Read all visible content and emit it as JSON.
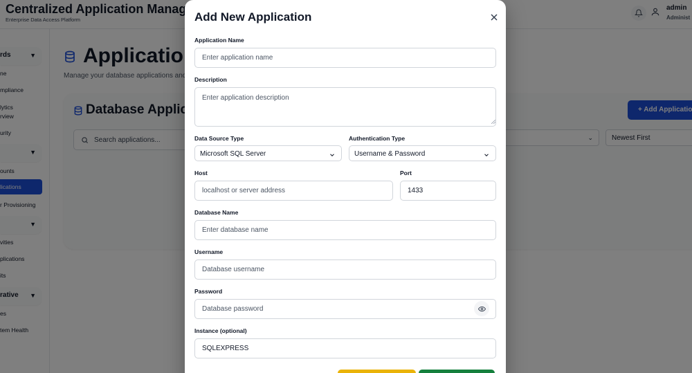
{
  "app": {
    "title": "Centralized Application Manageme",
    "subtitle": "Enterprise Data Access Platform",
    "user_name": "admin",
    "user_role": "Administ"
  },
  "sidebar": {
    "groups": [
      "rds",
      "",
      "",
      "rative"
    ],
    "items": [
      "ne",
      "mpliance",
      "lytics",
      "rview",
      "urity",
      "ounts",
      "lications",
      "r Provisioning",
      "vities",
      "plications",
      "its",
      "es",
      "tem Health"
    ],
    "active_index": 6
  },
  "page": {
    "title": "Application",
    "subtitle": "Manage your database applications and c",
    "card_title": "Database Applic",
    "add_button": "+ Add Applicatio",
    "search_placeholder": "Search applications...",
    "sort_value": "Newest First"
  },
  "modal": {
    "title": "Add New Application",
    "app_name": {
      "label": "Application Name",
      "placeholder": "Enter application name"
    },
    "description": {
      "label": "Description",
      "placeholder": "Enter application description"
    },
    "data_source": {
      "label": "Data Source Type",
      "value": "Microsoft SQL Server"
    },
    "auth_type": {
      "label": "Authentication Type",
      "value": "Username & Password"
    },
    "host": {
      "label": "Host",
      "placeholder": "localhost or server address"
    },
    "port": {
      "label": "Port",
      "value": "1433"
    },
    "database": {
      "label": "Database Name",
      "placeholder": "Enter database name"
    },
    "username": {
      "label": "Username",
      "placeholder": "Database username"
    },
    "password": {
      "label": "Password",
      "placeholder": "Database password"
    },
    "instance": {
      "label": "Instance (optional)",
      "value": "SQLEXPRESS"
    }
  },
  "colors": {
    "primary": "#1d4ed8",
    "overlay": "#000000",
    "warning_button": "#eab308",
    "success_button": "#15803d"
  }
}
